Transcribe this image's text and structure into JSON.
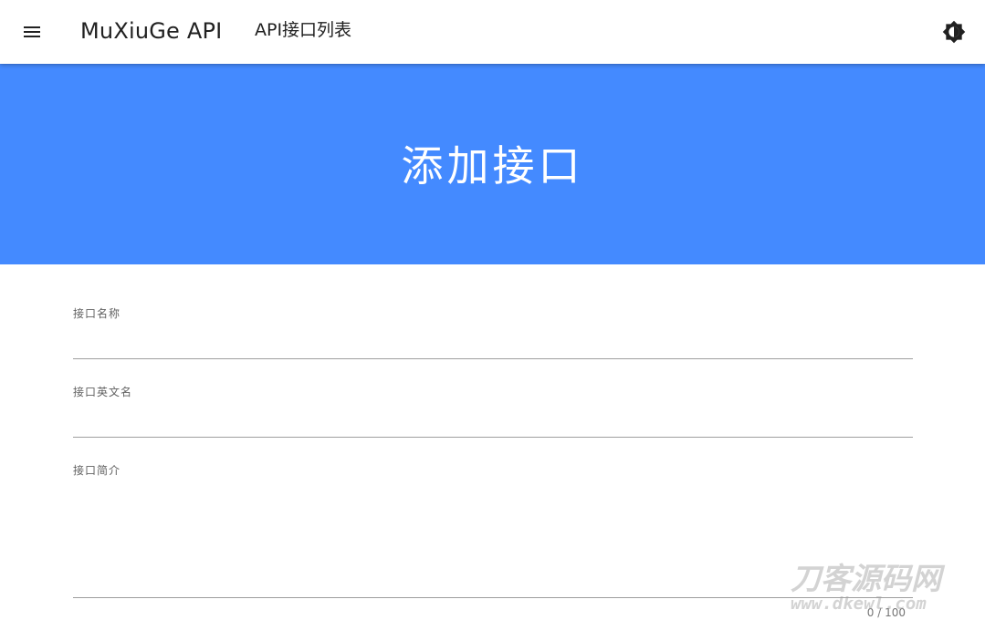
{
  "appbar": {
    "menu_icon": "menu-icon",
    "brand": "MuXiuGe API",
    "nav_link": "API接口列表",
    "theme_icon": "brightness-icon"
  },
  "hero": {
    "title": "添加接口",
    "background": "#448aff"
  },
  "form": {
    "fields": [
      {
        "label": "接口名称",
        "value": ""
      },
      {
        "label": "接口英文名",
        "value": ""
      },
      {
        "label": "接口简介",
        "value": "",
        "counter": "0 / 100"
      }
    ]
  },
  "watermark": {
    "brand": "刀客源码网",
    "url": "www.dkewl.com"
  }
}
